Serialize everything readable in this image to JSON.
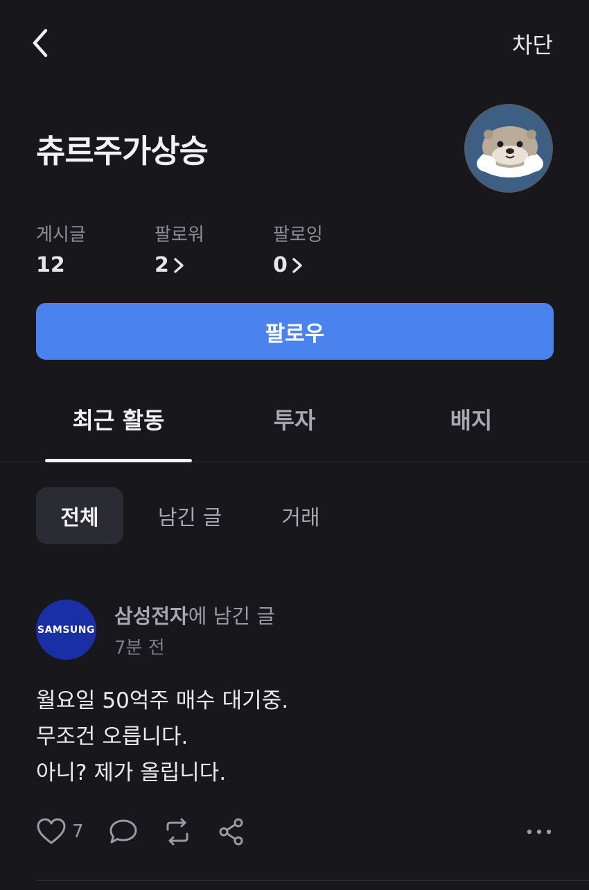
{
  "header": {
    "block_label": "차단"
  },
  "profile": {
    "name": "츄르주가상승",
    "stats": [
      {
        "label": "게시글",
        "value": "12"
      },
      {
        "label": "팔로워",
        "value": "2"
      },
      {
        "label": "팔로잉",
        "value": "0"
      }
    ],
    "follow_label": "팔로우"
  },
  "tabs": [
    {
      "label": "최근 활동",
      "active": true
    },
    {
      "label": "투자",
      "active": false
    },
    {
      "label": "배지",
      "active": false
    }
  ],
  "filters": [
    {
      "label": "전체",
      "active": true
    },
    {
      "label": "남긴 글",
      "active": false
    },
    {
      "label": "거래",
      "active": false
    }
  ],
  "post": {
    "stock_logo_text": "SAMSUNG",
    "stock_name": "삼성전자",
    "meta_suffix": "에 남긴 글",
    "time": "7분 전",
    "lines": [
      "월요일 50억주 매수 대기중.",
      "무조건 오릅니다.",
      "아니? 제가 올립니다."
    ],
    "like_count": "7"
  },
  "colors": {
    "background": "#17171c",
    "accent": "#4a83ee",
    "samsung_blue": "#1a2ea5"
  }
}
